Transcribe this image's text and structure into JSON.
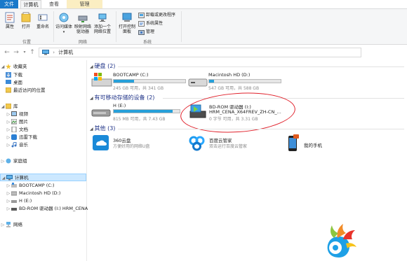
{
  "tabs": {
    "file": "文件",
    "computer": "计算机",
    "view": "查看",
    "manage": "管理"
  },
  "ribbon": {
    "properties": "属性",
    "open": "打开",
    "rename": "重命名",
    "access_media": "访问媒体",
    "map_drive": "映射网络驱动器",
    "add_location": "添加一个网络位置",
    "open_control_panel": "打开控制面板",
    "uninstall": "卸载或更改程序",
    "system_properties": "系统属性",
    "manage": "管理",
    "group_location": "位置",
    "group_network": "网络",
    "group_system": "系统"
  },
  "address": {
    "path": "计算机"
  },
  "nav": {
    "favorites": "收藏夹",
    "downloads": "下载",
    "desktop": "桌面",
    "recent": "最近访问的位置",
    "libraries": "库",
    "videos": "视频",
    "pictures": "图片",
    "documents": "文档",
    "thunder": "迅雷下载",
    "music": "音乐",
    "homegroup": "家庭组",
    "computer": "计算机",
    "bootcamp": "BOOTCAMP (C:)",
    "macintosh": "Macintosh HD (D:)",
    "h": "H (E:)",
    "bdrom": "BD-ROM 驱动器 (I:) HRM_CENA",
    "network": "网络"
  },
  "sections": {
    "hard_disks": "硬盘 (2)",
    "removable": "有可移动存储的设备 (2)",
    "other": "其他 (3)"
  },
  "drives": {
    "bootcamp": {
      "name": "BOOTCAMP (C:)",
      "space": "245 GB 可用，共 341 GB",
      "used_fraction": 0.28
    },
    "macintosh": {
      "name": "Macintosh HD (D:)",
      "space": "547 GB 可用，共 588 GB",
      "used_fraction": 0.07
    },
    "h": {
      "name": "H (E:)",
      "space": "815 MB 可用，共 7.43 GB",
      "used_fraction": 0.89
    },
    "bdrom": {
      "name": "BD-ROM 驱动器 (I:)",
      "label": "HRM_CENA_X64FREV_ZH-CN_...",
      "space": "0 字节 可用，共 3.31 GB"
    }
  },
  "other_items": {
    "yun360": {
      "name": "360云盘",
      "desc": "方便好用的网络U盘"
    },
    "baidu": {
      "name": "百度云管家",
      "desc": "双击运行百度云管家"
    },
    "phone": {
      "name": "我的手机"
    }
  },
  "colors": {
    "accent": "#1979ca",
    "bar_fill": "#26a0da",
    "annotation": "#e0202a",
    "section_title": "#1e3287"
  }
}
